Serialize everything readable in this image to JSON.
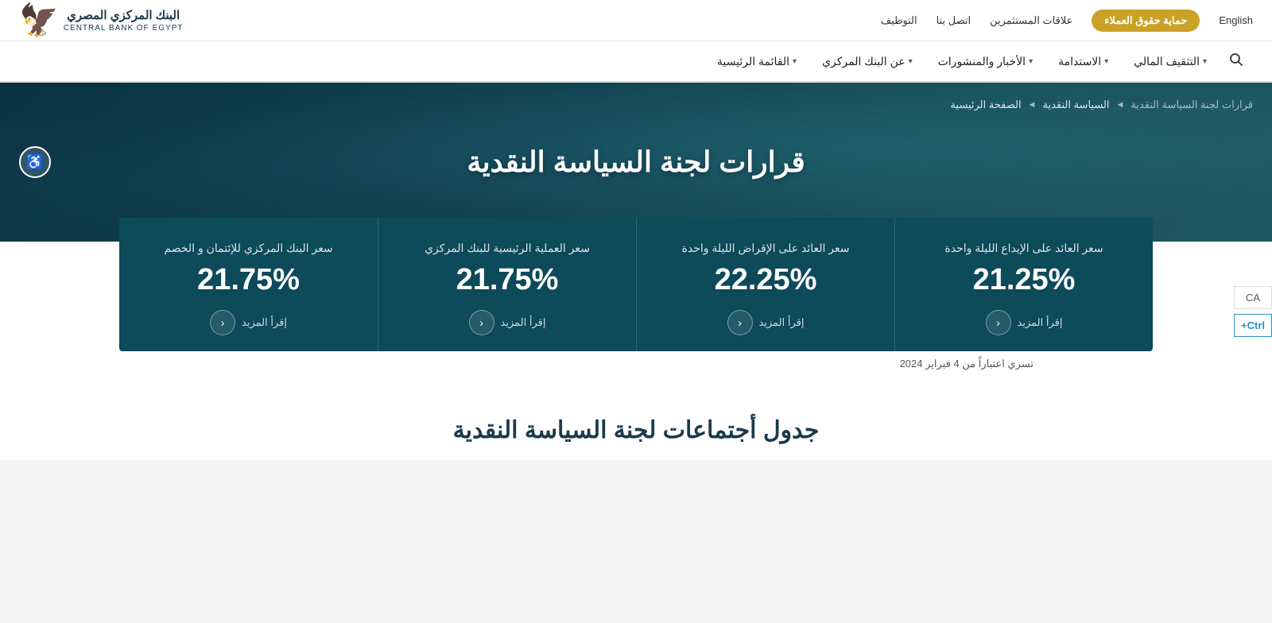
{
  "topbar": {
    "english_label": "English",
    "consumer_btn": "حماية حقوق العملاء",
    "nav_links": [
      {
        "label": "التوظيف"
      },
      {
        "label": "اتصل بنا"
      },
      {
        "label": "علاقات المستثمرين"
      }
    ]
  },
  "logo": {
    "arabic_line1": "البنك المركزي المصري",
    "english_name": "CENTRAL BANK OF EGYPT",
    "emblem": "🦅"
  },
  "mainnav": {
    "search_placeholder": "بحث",
    "items": [
      {
        "label": "القائمة الرئيسية",
        "has_dropdown": true
      },
      {
        "label": "عن البنك المركزي",
        "has_dropdown": true
      },
      {
        "label": "الأخبار والمنشورات",
        "has_dropdown": true
      },
      {
        "label": "الاستدامة",
        "has_dropdown": true
      },
      {
        "label": "التثقيف المالي",
        "has_dropdown": true
      }
    ]
  },
  "hero": {
    "title": "قرارات لجنة السياسة النقدية",
    "breadcrumb": [
      {
        "label": "الصفحة الرئيسية",
        "link": true
      },
      {
        "label": "السياسة النقدية",
        "link": true
      },
      {
        "label": "قرارات لجنة السياسة النقدية",
        "link": false
      }
    ]
  },
  "rates": [
    {
      "label": "سعر العائد على الإيداع الليلة واحدة",
      "value": "21.25%",
      "more_text": "إقرأ المزيد"
    },
    {
      "label": "سعر العائد على الإقراض الليلة واحدة",
      "value": "22.25%",
      "more_text": "إقرأ المزيد"
    },
    {
      "label": "سعر العملية الرئيسية للبنك المركزي",
      "value": "21.75%",
      "more_text": "إقرأ المزيد"
    },
    {
      "label": "سعر البنك المركزي للإئتمان و الخصم",
      "value": "21.75%",
      "more_text": "إقرأ المزيد"
    }
  ],
  "effective_date": "تسري اعتباراً من 4 فبراير 2024",
  "schedule_title": "جدول أجتماعات لجنة السياسة النقدية",
  "side_tools": {
    "translate": "CA",
    "zoom": "Ctrl+"
  },
  "accessibility_label": "♿"
}
